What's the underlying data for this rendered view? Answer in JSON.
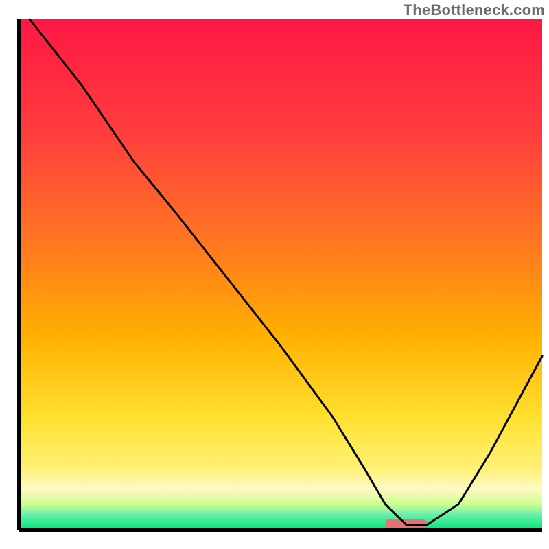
{
  "watermark": "TheBottleneck.com",
  "chart_data": {
    "type": "line",
    "title": "",
    "xlabel": "",
    "ylabel": "",
    "xlim": [
      0,
      100
    ],
    "ylim": [
      0,
      100
    ],
    "gradient_stops": [
      {
        "offset": 0,
        "color": "#ff1744"
      },
      {
        "offset": 22,
        "color": "#ff3d3d"
      },
      {
        "offset": 45,
        "color": "#ff7a1f"
      },
      {
        "offset": 62,
        "color": "#ffb000"
      },
      {
        "offset": 78,
        "color": "#ffe030"
      },
      {
        "offset": 88,
        "color": "#fff176"
      },
      {
        "offset": 92,
        "color": "#fff9c4"
      },
      {
        "offset": 95,
        "color": "#ccff90"
      },
      {
        "offset": 97,
        "color": "#69f0ae"
      },
      {
        "offset": 100,
        "color": "#00e676"
      }
    ],
    "series": [
      {
        "name": "bottleneck-curve",
        "x": [
          2,
          12,
          22,
          30,
          40,
          50,
          60,
          66,
          70,
          74,
          78,
          84,
          90,
          100
        ],
        "y": [
          100,
          87,
          72,
          62,
          49,
          36,
          22,
          12,
          5,
          1,
          1,
          5,
          15,
          34
        ]
      }
    ],
    "marker": {
      "x_start": 70,
      "x_end": 78,
      "color": "#e57373"
    },
    "axis_color": "#000000"
  }
}
